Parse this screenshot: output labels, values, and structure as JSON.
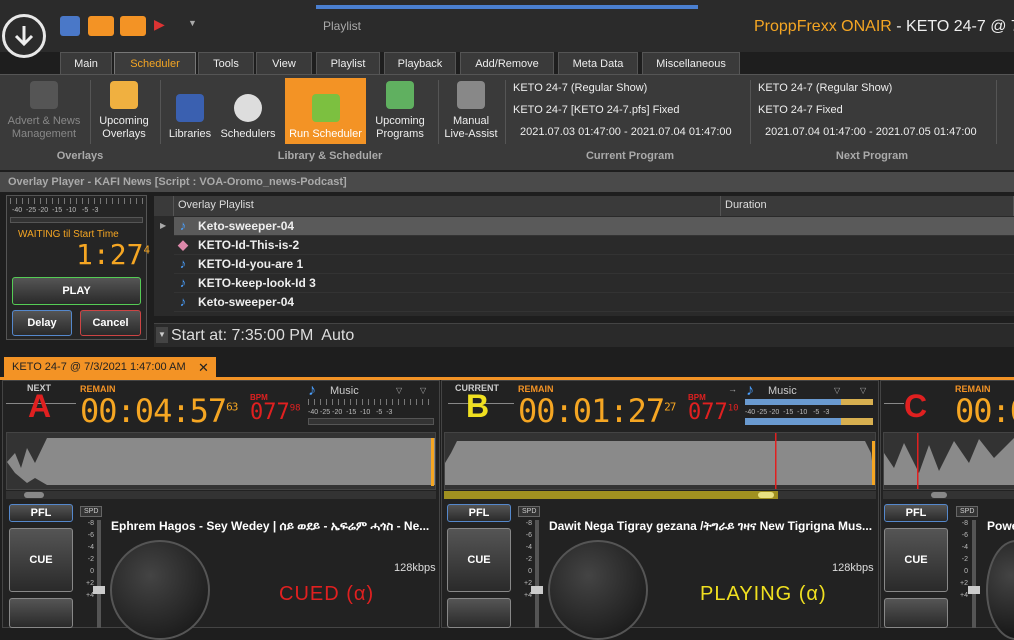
{
  "title": {
    "brand": "ProppFrexx ONAIR",
    "rest": " - KETO 24-7 @ 7"
  },
  "context_label": "Playlist",
  "tabs": [
    "Main",
    "Scheduler",
    "Tools",
    "View",
    "Playlist",
    "Playback",
    "Add/Remove",
    "Meta Data",
    "Miscellaneous"
  ],
  "ribbon": {
    "advert": "Advert & News Management",
    "upcoming_overlays": "Upcoming Overlays",
    "libraries": "Libraries",
    "schedulers": "Schedulers",
    "run_scheduler": "Run Scheduler",
    "upcoming_programs": "Upcoming Programs",
    "manual_assist": "Manual Live-Assist",
    "groups": {
      "overlays": "Overlays",
      "library": "Library & Scheduler",
      "current": "Current Program",
      "next": "Next Program"
    },
    "current": {
      "l1": "KETO 24-7 (Regular Show)",
      "l2": "KETO 24-7 [KETO 24-7.pfs] Fixed",
      "l3": "2021.07.03 01:47:00 - 2021.07.04 01:47:00"
    },
    "next": {
      "l1": "KETO 24-7 (Regular Show)",
      "l2": "KETO 24-7 Fixed",
      "l3": "2021.07.04 01:47:00 - 2021.07.05 01:47:00"
    }
  },
  "overlay": {
    "title": "Overlay Player - KAFI News [Script : VOA-Oromo_news-Podcast]",
    "meter_scale": "-40  -25 -20  -15  -10   -5  -3",
    "waiting": "WAITING til Start Time",
    "time": "1:27",
    "time_sup": "4",
    "play": "PLAY",
    "delay": "Delay",
    "cancel": "Cancel",
    "col_playlist": "Overlay Playlist",
    "col_duration": "Duration",
    "items": [
      "Keto-sweeper-04",
      "KETO-Id-This-is-2",
      "KETO-Id-you-are 1",
      "KETO-keep-look-Id 3",
      "Keto-sweeper-04"
    ],
    "start_at": "Start at: 7:35:00 PM  Auto"
  },
  "deck_tab": "KETO 24-7 @ 7/3/2021 1:47:00 AM",
  "decks": [
    {
      "tag": "NEXT",
      "letter": "A",
      "letter_color": "#e02020",
      "remain": "REMAIN",
      "time": "00:04:57",
      "time_sup": "63",
      "bpm_lbl": "BPM",
      "bpm": "077",
      "bpm_sup": "98",
      "type": "Music",
      "meter_scale": "-40 -25 -20  -15  -10   -5  -3",
      "track": "Ephrem Hagos - Sey Wedey | ሰይ ወደይ - ኤፍሬም ሓጎስ - Ne...",
      "kbps": "128kbps",
      "status": "CUED  (α)",
      "status_color": "#e02020",
      "pfl": "PFL",
      "spd": "SPD",
      "cue": "CUE",
      "pitch": [
        "-8",
        "-6",
        "-4",
        "-2",
        "0",
        "+2",
        "+4"
      ]
    },
    {
      "tag": "CURRENT",
      "letter": "B",
      "letter_color": "#f0e020",
      "remain": "REMAIN",
      "time": "00:01:27",
      "time_sup": "27",
      "bpm_lbl": "BPM",
      "bpm": "077",
      "bpm_sup": "10",
      "type": "Music",
      "meter_scale": "-40 -25 -20  -15  -10   -5  -3",
      "track": "Dawit Nega Tigray gezana /ትግራይ ገዛና New Tigrigna Mus...",
      "kbps": "128kbps",
      "status": "PLAYING  (α)",
      "status_color": "#f0e020",
      "pfl": "PFL",
      "spd": "SPD",
      "cue": "CUE",
      "pitch": [
        "-8",
        "-6",
        "-4",
        "-2",
        "0",
        "+2",
        "+4"
      ]
    },
    {
      "letter": "C",
      "letter_color": "#e02020",
      "remain": "REMAIN",
      "time": "00:0",
      "pfl": "PFL",
      "spd": "SPD",
      "cue": "CUE",
      "track": "Powe",
      "pitch": [
        "-8",
        "-6",
        "-4",
        "-2",
        "0",
        "+2",
        "+4"
      ]
    }
  ]
}
